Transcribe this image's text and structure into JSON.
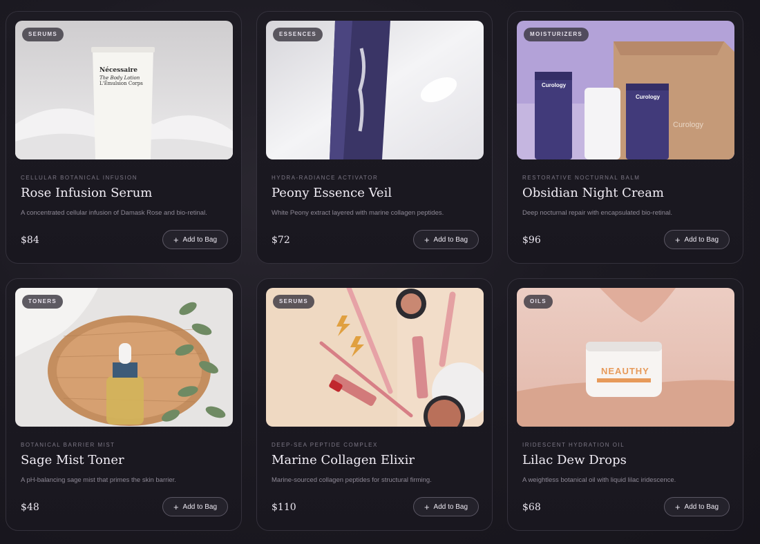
{
  "products": [
    {
      "badge": "SERUMS",
      "kicker": "CELLULAR BOTANICAL INFUSION",
      "title": "Rose Infusion Serum",
      "desc": "A concentrated cellular infusion of Damask Rose and bio-retinal.",
      "price": "$84",
      "cta": "Add to Bag",
      "image_text": [
        "Nécessaire",
        "The Body Lotion",
        "L'Émulsion Corps"
      ]
    },
    {
      "badge": "ESSENCES",
      "kicker": "HYDRA-RADIANCE ACTIVATOR",
      "title": "Peony Essence Veil",
      "desc": "White Peony extract layered with marine collagen peptides.",
      "price": "$72",
      "cta": "Add to Bag",
      "image_text": []
    },
    {
      "badge": "MOISTURIZERS",
      "kicker": "RESTORATIVE NOCTURNAL BALM",
      "title": "Obsidian Night Cream",
      "desc": "Deep nocturnal repair with encapsulated bio-retinal.",
      "price": "$96",
      "cta": "Add to Bag",
      "image_text": [
        "Curology",
        "Curology",
        "Curology"
      ]
    },
    {
      "badge": "TONERS",
      "kicker": "BOTANICAL BARRIER MIST",
      "title": "Sage Mist Toner",
      "desc": "A pH-balancing sage mist that primes the skin barrier.",
      "price": "$48",
      "cta": "Add to Bag",
      "image_text": []
    },
    {
      "badge": "SERUMS",
      "kicker": "DEEP-SEA PEPTIDE COMPLEX",
      "title": "Marine Collagen Elixir",
      "desc": "Marine-sourced collagen peptides for structural firming.",
      "price": "$110",
      "cta": "Add to Bag",
      "image_text": []
    },
    {
      "badge": "OILS",
      "kicker": "IRIDESCENT HYDRATION OIL",
      "title": "Lilac Dew Drops",
      "desc": "A weightless botanical oil with liquid lilac iridescence.",
      "price": "$68",
      "cta": "Add to Bag",
      "image_text": [
        "NEAUTHY"
      ]
    }
  ]
}
